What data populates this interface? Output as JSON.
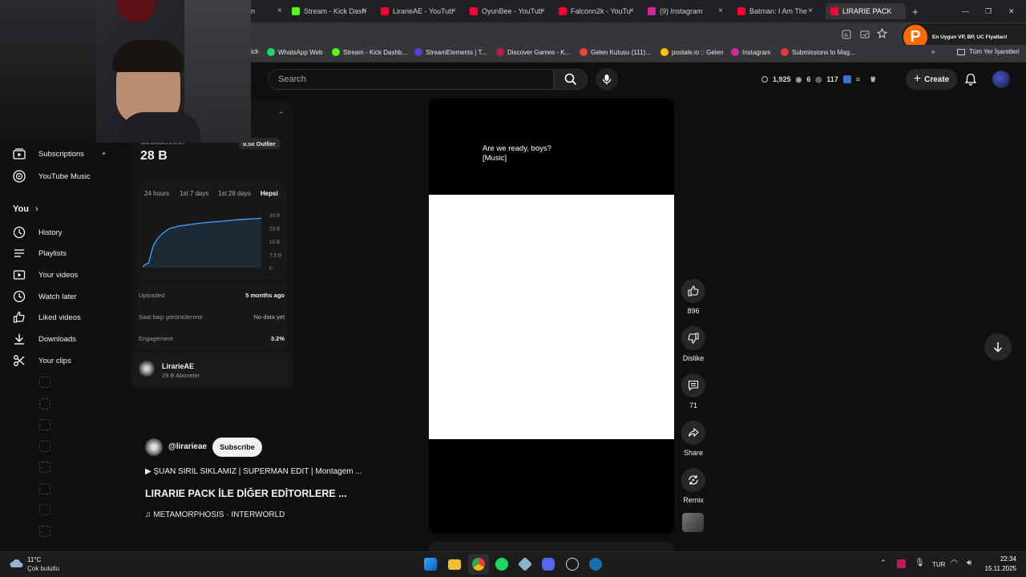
{
  "browser": {
    "tabs": [
      {
        "label": "n",
        "color": "#888"
      },
      {
        "label": "Stream - Kick Dash",
        "color": "#53fc18"
      },
      {
        "label": "LirarieAE - YouTub",
        "color": "#ff0033"
      },
      {
        "label": "OyunBee - YouTub",
        "color": "#ff0033"
      },
      {
        "label": "Falconn2k - YouTu",
        "color": "#ff0033"
      },
      {
        "label": "(9) Instagram",
        "color": "#d6249f"
      },
      {
        "label": "Batman: I Am The",
        "color": "#ff0033"
      },
      {
        "label": "LIRARIE PACK",
        "color": "#ff0033"
      }
    ],
    "new_tab_label": "+",
    "bookmarks": [
      "ick",
      "WhatsApp Web",
      "Stream - Kick Dashb...",
      "StreamElements | T...",
      "Discover Games - K...",
      "Gelen Kutusu (111)...",
      "postale.io :: Gelen",
      "Instagram",
      "Submissions to Mag..."
    ],
    "all_bookmarks": "Tüm Yer İşaretleri",
    "ad_text": "En Uygun VP, BP, UC Fiyatları!",
    "ad_letter": "P"
  },
  "header": {
    "search_placeholder": "Search",
    "stats": {
      "views": "1,925",
      "eye": "6",
      "watch": "117"
    },
    "create_label": "Create"
  },
  "sidebar": {
    "subscriptions": "Subscriptions",
    "youtube_music": "YouTube Music",
    "you": "You",
    "items": [
      "History",
      "Playlists",
      "Your videos",
      "Watch later",
      "Liked videos",
      "Downloads",
      "Your clips"
    ]
  },
  "panel": {
    "views_label": "Görüntülenmeler",
    "views_value": "28 B",
    "outlier": "0.5x Outlier",
    "ranges": [
      "24 hours",
      "1st 7 days",
      "1st 28 days",
      "Hepsi"
    ],
    "uploaded_label": "Uploaded",
    "uploaded_value": "5 months ago",
    "hourly_label": "Saat başı görüntülenme",
    "hourly_value": "No data yet",
    "engagement_label": "Engagement",
    "engagement_value": "3.2%",
    "channel_name": "LirarieAE",
    "channel_subs": "29 B Aboneler"
  },
  "chart_data": {
    "type": "area",
    "title": "",
    "xlabel": "",
    "ylabel": "",
    "y_ticks": [
      "30 B",
      "23 B",
      "15 B",
      "7.5 B",
      "0"
    ],
    "ylim": [
      0,
      30000
    ],
    "x": [
      0,
      3,
      5,
      7,
      9,
      12,
      16,
      22,
      30,
      40,
      52,
      66,
      80,
      100
    ],
    "values": [
      500,
      2200,
      2500,
      8000,
      12500,
      16000,
      19000,
      22000,
      23500,
      24500,
      25500,
      26300,
      27200,
      28000
    ],
    "color": "#3ea6ff",
    "grid": false
  },
  "short": {
    "caption_line1": "Are we ready, boys?",
    "caption_line2": "[Music]",
    "likes": "896",
    "dislike_label": "Dislike",
    "comments": "71",
    "share_label": "Share",
    "remix_label": "Remix",
    "channel_handle": "@lirarieae",
    "subscribe_label": "Subscribe",
    "playlist_line": "▶ ŞUAN SIRIL SIKLAMIZ | SUPERMAN EDIT | Montagem ...",
    "title": "LIRARIE PACK İLE DİĞER EDİTORLERE ...",
    "music": "♫ METAMORPHOSIS · INTERWORLD"
  },
  "taskbar": {
    "weather_temp": "11°C",
    "weather_desc": "Çok bulutlu",
    "lang": "TUR",
    "time": "22:34",
    "date": "15.11.2025"
  }
}
